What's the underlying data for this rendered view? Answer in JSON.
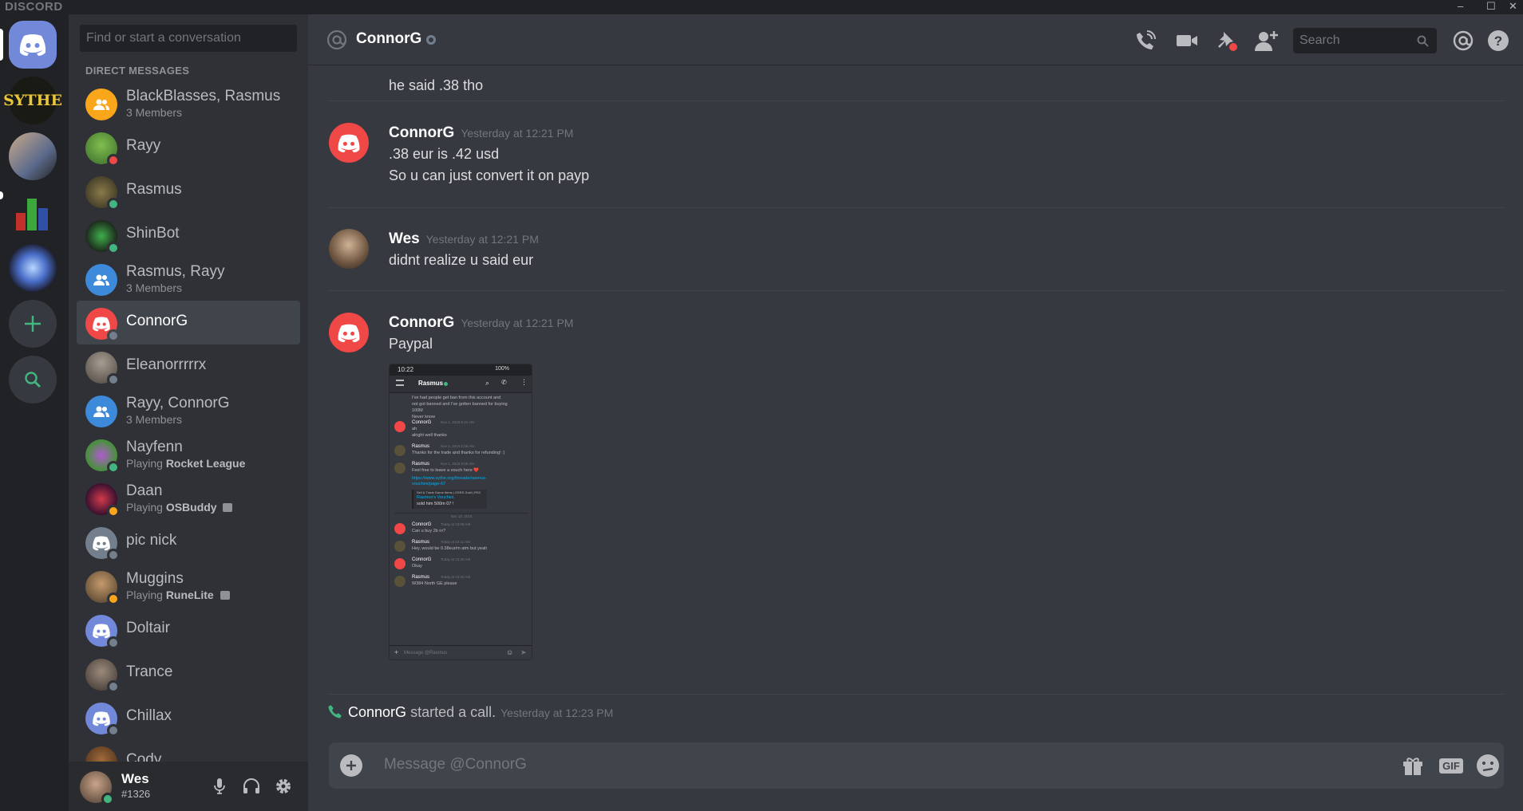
{
  "titlebar": {
    "brand": "DISCORD",
    "min": "‒",
    "max": "☐",
    "close": "✕"
  },
  "servers": [
    {
      "name": "home",
      "label": ""
    },
    {
      "name": "sythe",
      "label": "SYTHE"
    },
    {
      "name": "server-3",
      "label": ""
    },
    {
      "name": "server-4",
      "label": ""
    },
    {
      "name": "server-5",
      "label": ""
    }
  ],
  "dm": {
    "search_placeholder": "Find or start a conversation",
    "header": "DIRECT MESSAGES",
    "items": [
      {
        "name": "BlackBlasses, Rasmus",
        "sub": "3 Members",
        "color": "#faa61a",
        "group": true,
        "status": ""
      },
      {
        "name": "Rayy",
        "sub": "",
        "color": "#4e7a3a",
        "group": false,
        "status": "dnd"
      },
      {
        "name": "Rasmus",
        "sub": "",
        "color": "#5a5238",
        "group": false,
        "status": "online"
      },
      {
        "name": "ShinBot",
        "sub": "",
        "color": "#2b3a2b",
        "group": false,
        "status": "online"
      },
      {
        "name": "Rasmus, Rayy",
        "sub": "3 Members",
        "color": "#3c8ad9",
        "group": true,
        "status": ""
      },
      {
        "name": "ConnorG",
        "sub": "",
        "color": "#f04747",
        "group": false,
        "status": "offline",
        "active": true
      },
      {
        "name": "Eleanorrrrrx",
        "sub": "",
        "color": "#6b6259",
        "group": false,
        "status": "offline"
      },
      {
        "name": "Rayy, ConnorG",
        "sub": "3 Members",
        "color": "#3c8ad9",
        "group": true,
        "status": ""
      },
      {
        "name": "Nayfenn",
        "sub_prefix": "Playing ",
        "sub_game": "Rocket League",
        "color": "#4a8f3f",
        "group": false,
        "status": "online"
      },
      {
        "name": "Daan",
        "sub_prefix": "Playing ",
        "sub_game": "OSBuddy",
        "color": "#6a1f2b",
        "group": false,
        "status": "idle"
      },
      {
        "name": "pic nick",
        "sub": "",
        "color": "#747f8d",
        "group": false,
        "status": "offline"
      },
      {
        "name": "Muggins",
        "sub_prefix": "Playing ",
        "sub_game": "RuneLite",
        "color": "#7a5a3a",
        "group": false,
        "status": "idle"
      },
      {
        "name": "Doltair",
        "sub": "",
        "color": "#7289da",
        "group": false,
        "status": "offline"
      },
      {
        "name": "Trance",
        "sub": "",
        "color": "#5e5450",
        "group": false,
        "status": "offline"
      },
      {
        "name": "Chillax",
        "sub": "",
        "color": "#7289da",
        "group": false,
        "status": "offline"
      },
      {
        "name": "Cody",
        "sub": "",
        "color": "#6d4a30",
        "group": false,
        "status": "offline"
      }
    ]
  },
  "user": {
    "name": "Wes",
    "tag": "#1326"
  },
  "header": {
    "channel": "ConnorG",
    "search_placeholder": "Search"
  },
  "messages": {
    "top_text": "he said .38 tho",
    "m1": {
      "author": "ConnorG",
      "time": "Yesterday at 12:21 PM",
      "lines": [
        ".38 eur is .42 usd",
        "So u can just convert it on payp"
      ]
    },
    "m2": {
      "author": "Wes",
      "time": "Yesterday at 12:21 PM",
      "lines": [
        "didnt realize u said eur"
      ]
    },
    "m3": {
      "author": "ConnorG",
      "time": "Yesterday at 12:21 PM",
      "lines": [
        "Paypal"
      ]
    },
    "call": {
      "author": "ConnorG",
      "text": "started a call.",
      "time": "Yesterday at 12:23 PM"
    }
  },
  "attachment": {
    "status_time": "10:22",
    "status_right": "100%",
    "title": "Rasmus",
    "lines": [
      "I've had people get ban from this account and",
      "not got banned and I've gotten banned for buying",
      "100M",
      "Never know"
    ],
    "msgs": [
      {
        "author": "ConnorG",
        "time": "Nov 1, 2018 5:44 AM",
        "text": [
          "ah",
          "alright well thanks"
        ]
      },
      {
        "author": "Rasmus",
        "time": "Nov 1, 2018 5:46 AM",
        "text": [
          "Thanks for the trade and thanks for refunding! :)"
        ]
      },
      {
        "author": "Rasmus",
        "time": "Nov 1, 2018 5:50 AM",
        "text": [
          "Feel free to leave a vouch here ❤️"
        ]
      }
    ],
    "link": "https://www.sythe.org/threads/rasmus-vouches/page-67",
    "embed_site": "Sell & Trade Game Items | OSRS Gold | RS3",
    "embed_title": "Rasmus's Vouches",
    "embed_text": "sold him 500m 07 !",
    "divider": "Nov 18, 2018",
    "msgs2": [
      {
        "author": "ConnorG",
        "time": "Today at 10:08 AM",
        "text": [
          "Can u buy 2b rn?"
        ]
      },
      {
        "author": "Rasmus",
        "time": "Today at 10:11 AM",
        "text": [
          "Hey, would be 0.38eur/m atm but yeah"
        ]
      },
      {
        "author": "ConnorG",
        "time": "Today at 10:20 AM",
        "text": [
          "Okay"
        ]
      },
      {
        "author": "Rasmus",
        "time": "Today at 10:20 AM",
        "text": [
          "W384 North GE please"
        ]
      }
    ],
    "input": "Message @Rasmus"
  },
  "composer": {
    "placeholder": "Message @ConnorG",
    "gif": "GIF"
  },
  "colors": {
    "accent": "#7289da",
    "red": "#f04747",
    "green": "#43b581"
  }
}
